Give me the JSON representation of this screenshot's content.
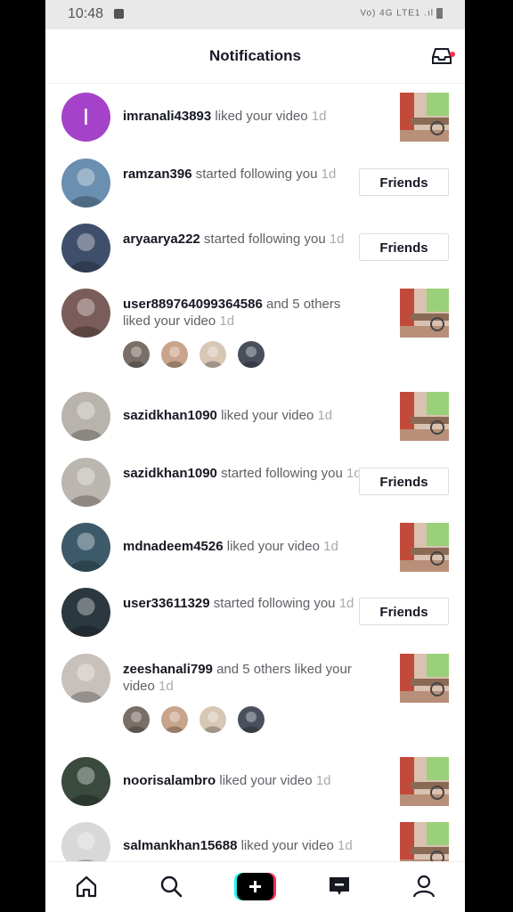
{
  "status_bar": {
    "time": "10:48",
    "indicators": "Vo) 4G LTE1 .ıl"
  },
  "header": {
    "title": "Notifications"
  },
  "notifications": [
    {
      "user": "imranali43893",
      "action": " liked your video ",
      "time": "1d",
      "avatar_letter": "I",
      "right": "thumb"
    },
    {
      "user": "ramzan396",
      "action": " started following you ",
      "time": "1d",
      "right": "friends"
    },
    {
      "user": "aryaarya222",
      "action": " started following you ",
      "time": "1d",
      "right": "friends"
    },
    {
      "user": "user889764099364586",
      "action": " and 5 others liked your video ",
      "time": "1d",
      "right": "thumb",
      "minis": 4
    },
    {
      "user": "sazidkhan1090",
      "action": " liked your video ",
      "time": "1d",
      "right": "thumb"
    },
    {
      "user": "sazidkhan1090",
      "action": " started following you ",
      "time": "1d",
      "right": "friends"
    },
    {
      "user": "mdnadeem4526",
      "action": " liked your video ",
      "time": "1d",
      "right": "thumb"
    },
    {
      "user": "user33611329",
      "action": " started following you ",
      "time": "1d",
      "right": "friends"
    },
    {
      "user": "zeeshanali799",
      "action": " and 5 others liked your video ",
      "time": "1d",
      "right": "thumb",
      "minis": 4
    },
    {
      "user": "noorisalambro",
      "action": " liked your video ",
      "time": "1d",
      "right": "thumb"
    },
    {
      "user": "salmankhan15688",
      "action": " liked your video ",
      "time": "1d",
      "right": "thumb"
    }
  ],
  "friends_label": "Friends",
  "nav": [
    {
      "name": "home",
      "icon": "home-icon"
    },
    {
      "name": "discover",
      "icon": "search-icon"
    },
    {
      "name": "create",
      "icon": "plus-icon"
    },
    {
      "name": "inbox",
      "icon": "message-icon"
    },
    {
      "name": "profile",
      "icon": "person-icon"
    }
  ],
  "colors": {
    "accent": "#fe2c55",
    "cyan": "#25f4ee",
    "avatar_purple": "#a443c9",
    "text_dark": "#161823"
  }
}
